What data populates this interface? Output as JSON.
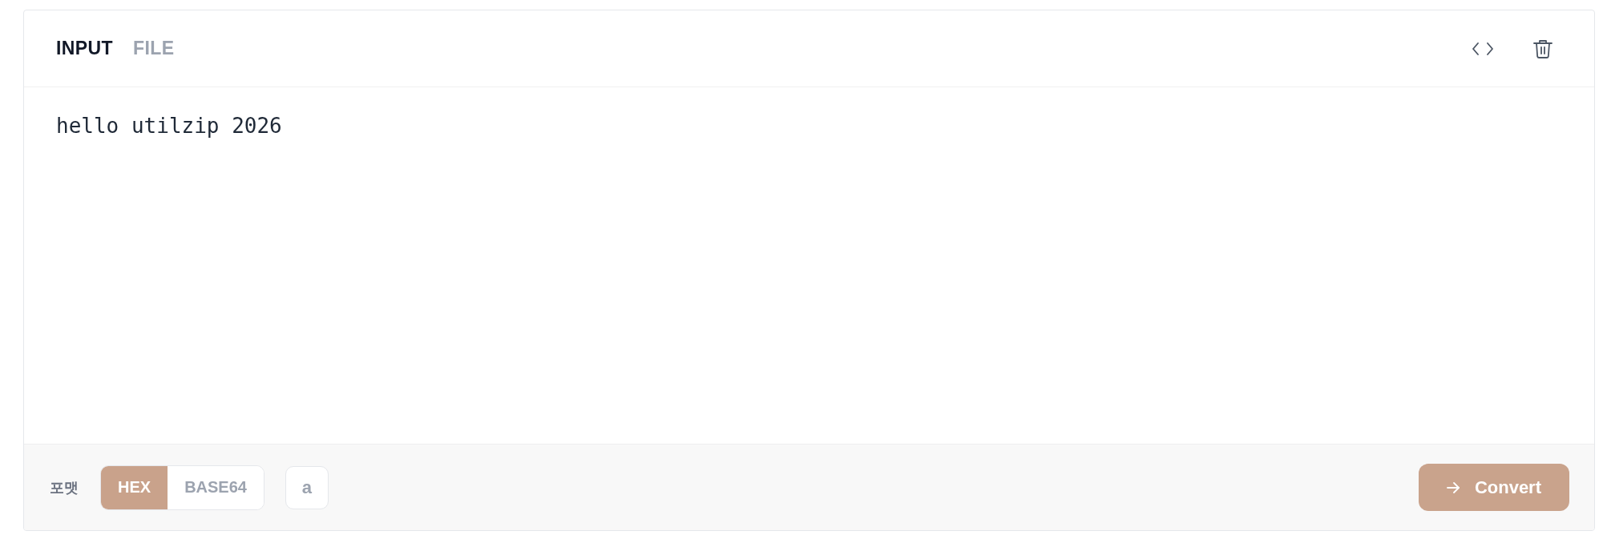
{
  "tabs": [
    {
      "label": "INPUT",
      "selected": true
    },
    {
      "label": "FILE",
      "selected": false
    }
  ],
  "input": {
    "value": "hello utilzip 2026"
  },
  "footer": {
    "format_label": "포맷",
    "formats": [
      {
        "label": "HEX",
        "selected": true
      },
      {
        "label": "BASE64",
        "selected": false
      }
    ],
    "case_button": {
      "label": "a",
      "selected": false
    },
    "convert_button": {
      "label": "Convert"
    }
  }
}
